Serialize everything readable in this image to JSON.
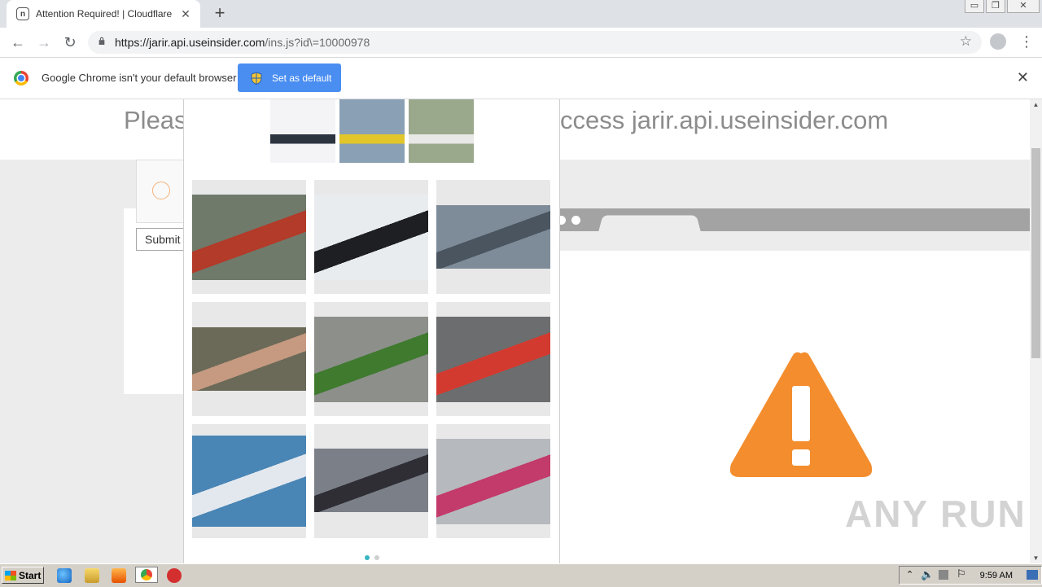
{
  "browser": {
    "tab_title": "Attention Required! | Cloudflare",
    "tab_favicon": "cloudflare-favicon",
    "new_tab_symbol": "+",
    "url_host": "https://jarir.api.useinsider.com",
    "url_path": "/ins.js?id\\=10000978",
    "window_controls": [
      "minimize",
      "restore",
      "close"
    ]
  },
  "infobar": {
    "message": "Google Chrome isn't your default browser",
    "button_label": "Set as default",
    "button_color": "#4a8ef1"
  },
  "page": {
    "heading_left": "Pleas",
    "heading_right": "ccess jarir.api.useinsider.com",
    "submit_label": "Submit",
    "warning_color": "#f38d2e",
    "watermark": "ANY RUN"
  },
  "challenge": {
    "sample_images": [
      {
        "name": "fighter-jet-sample",
        "colors": [
          "#f4f4f6",
          "#2c3440"
        ]
      },
      {
        "name": "yellow-airliner-sample",
        "colors": [
          "#8aa0b5",
          "#e2c62a"
        ]
      },
      {
        "name": "white-airliner-sample",
        "colors": [
          "#9aa88c",
          "#e8e8e6"
        ]
      }
    ],
    "tiles": [
      {
        "name": "dragon-boat-tile",
        "bg": "#6f7a6a",
        "accent": "#b23b2a"
      },
      {
        "name": "motorcycle-tail-tile",
        "bg": "#e9ecef",
        "accent": "#1d1f22"
      },
      {
        "name": "carrier-jet-tile",
        "bg": "#7e8b99",
        "accent": "#4a5560"
      },
      {
        "name": "soldier-tile",
        "bg": "#6b6a58",
        "accent": "#c59a80"
      },
      {
        "name": "bus-tile",
        "bg": "#8c8f8a",
        "accent": "#3f7a2f"
      },
      {
        "name": "red-plane-tile",
        "bg": "#6b6d6e",
        "accent": "#d33a2f"
      },
      {
        "name": "blue-jet-tile",
        "bg": "#4a86b5",
        "accent": "#e3e8ee"
      },
      {
        "name": "street-tram-tile",
        "bg": "#7b7f88",
        "accent": "#2e2e34"
      },
      {
        "name": "commuter-train-tile",
        "bg": "#b6b9bd",
        "accent": "#c23b6a"
      }
    ],
    "active_page_color": "#36b5c1",
    "inactive_page_color": "#cfcfcf"
  },
  "taskbar": {
    "start_label": "Start",
    "clock": "9:59 AM",
    "quick_launch_icons": [
      "ie-icon",
      "explorer-icon",
      "media-player-icon",
      "chrome-icon",
      "antivirus-icon"
    ]
  }
}
